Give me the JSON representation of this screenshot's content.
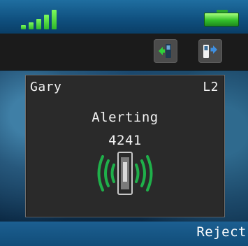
{
  "status_bar": {
    "signal_icon": "signal-strength-icon",
    "signal_bars": 5,
    "battery_icon": "battery-icon",
    "battery_level": 1.0,
    "accent_color": "#2eb82a"
  },
  "toolbar": {
    "buttons": [
      {
        "icon": "call-transfer-icon"
      },
      {
        "icon": "call-handover-icon"
      }
    ]
  },
  "call": {
    "caller_name": "Gary",
    "line": "L2",
    "status": "Alerting",
    "number": "4241",
    "ringing_icon": "ringing-handset-icon"
  },
  "softkeys": {
    "right_label": "Reject"
  }
}
